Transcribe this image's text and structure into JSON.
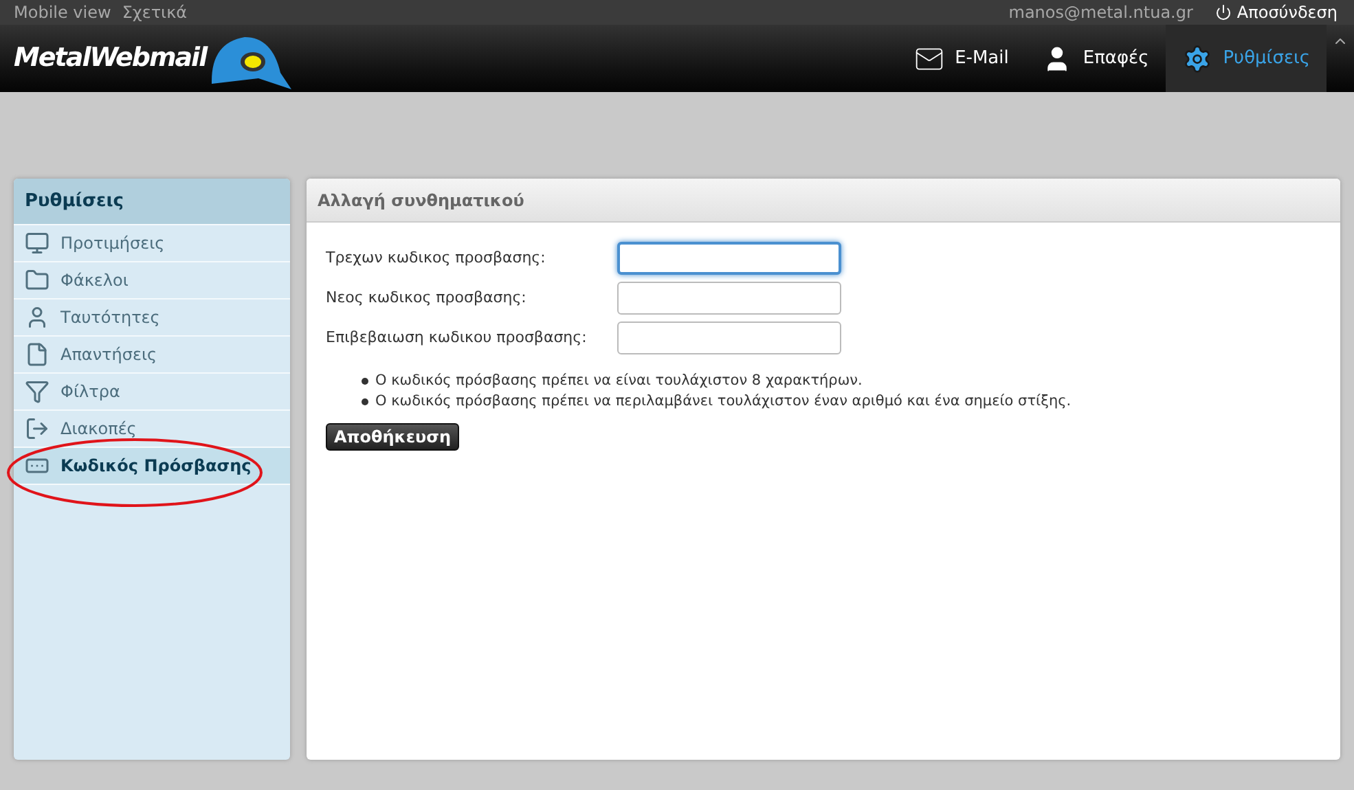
{
  "top_bar": {
    "links": [
      "Mobile view",
      "Σχετικά"
    ],
    "user": "manos@metal.ntua.gr",
    "logout": "Αποσύνδεση"
  },
  "header": {
    "logo": "MetalWebmail",
    "nav": [
      {
        "label": "E-Mail",
        "selected": false
      },
      {
        "label": "Επαφές",
        "selected": false
      },
      {
        "label": "Ρυθμίσεις",
        "selected": true
      }
    ]
  },
  "sidebar": {
    "title": "Ρυθμίσεις",
    "items": [
      {
        "label": "Προτιμήσεις",
        "selected": false
      },
      {
        "label": "Φάκελοι",
        "selected": false
      },
      {
        "label": "Ταυτότητες",
        "selected": false
      },
      {
        "label": "Απαντήσεις",
        "selected": false
      },
      {
        "label": "Φίλτρα",
        "selected": false
      },
      {
        "label": "Διακοπές",
        "selected": false
      },
      {
        "label": "Κωδικός Πρόσβασης",
        "selected": true
      }
    ]
  },
  "panel": {
    "title": "Αλλαγή συνθηματικού",
    "fields": [
      {
        "label": "Τρεχων κωδικος προσβασης:",
        "focused": true
      },
      {
        "label": "Νεος κωδικος προσβασης:",
        "focused": false
      },
      {
        "label": "Επιβεβαιωση κωδικου προσβασης:",
        "focused": false
      }
    ],
    "rules": [
      "Ο κωδικός πρόσβασης πρέπει να είναι τουλάχιστον 8 χαρακτήρων.",
      "Ο κωδικός πρόσβασης πρέπει να περιλαμβάνει τουλάχιστον έναν αριθμό και ένα σημείο στίξης."
    ],
    "save_button": "Αποθήκευση"
  }
}
